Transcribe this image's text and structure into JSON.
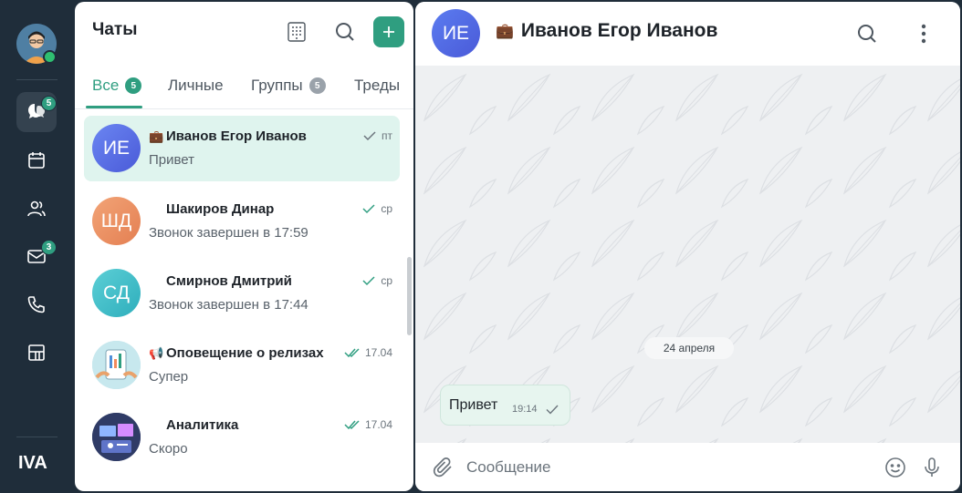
{
  "rail": {
    "items": [
      {
        "icon": "chat-bubbles-icon",
        "badge": "5"
      },
      {
        "icon": "calendar-icon",
        "badge": ""
      },
      {
        "icon": "contacts-icon",
        "badge": ""
      },
      {
        "icon": "mail-icon",
        "badge": "3"
      },
      {
        "icon": "phone-icon",
        "badge": ""
      },
      {
        "icon": "apps-icon",
        "badge": ""
      }
    ],
    "logo": "IVA"
  },
  "chat_list": {
    "title": "Чаты",
    "tabs": [
      {
        "label": "Все",
        "badge": "5"
      },
      {
        "label": "Личные",
        "badge": ""
      },
      {
        "label": "Группы",
        "badge": "5"
      },
      {
        "label": "Треды",
        "badge": ""
      }
    ],
    "items": [
      {
        "initials": "ИЕ",
        "prefix": "💼",
        "name": "Иванов Егор Иванов",
        "last_message": "Привет",
        "time": "пт",
        "status": "sent",
        "color": "#5a72e8"
      },
      {
        "initials": "ШД",
        "prefix": "",
        "name": "Шакиров Динар",
        "last_message": "Звонок завершен в 17:59",
        "time": "ср",
        "status": "sent",
        "color": "#ec8f62"
      },
      {
        "initials": "СД",
        "prefix": "",
        "name": "Смирнов Дмитрий",
        "last_message": "Звонок завершен в 17:44",
        "time": "ср",
        "status": "sent",
        "color": "#3fbcc7"
      },
      {
        "initials": "",
        "prefix": "📢",
        "name": "Оповещение о релизах",
        "last_message": "Супер",
        "time": "17.04",
        "status": "read",
        "color": "#bfe3ea"
      },
      {
        "initials": "",
        "prefix": "",
        "name": "Аналитика",
        "last_message": "Скоро",
        "time": "17.04",
        "status": "read",
        "color": "#3d4c7a"
      }
    ]
  },
  "conversation": {
    "initials": "ИЕ",
    "prefix": "💼",
    "title": "Иванов Егор Иванов",
    "date_separator": "24 апреля",
    "messages": [
      {
        "text": "Привет",
        "time": "19:14",
        "status": "sent"
      }
    ],
    "composer_placeholder": "Сообщение"
  },
  "colors": {
    "accent": "#2f9e80",
    "rail_bg": "#1f2d3a",
    "selected_bg": "#dff4ee"
  }
}
